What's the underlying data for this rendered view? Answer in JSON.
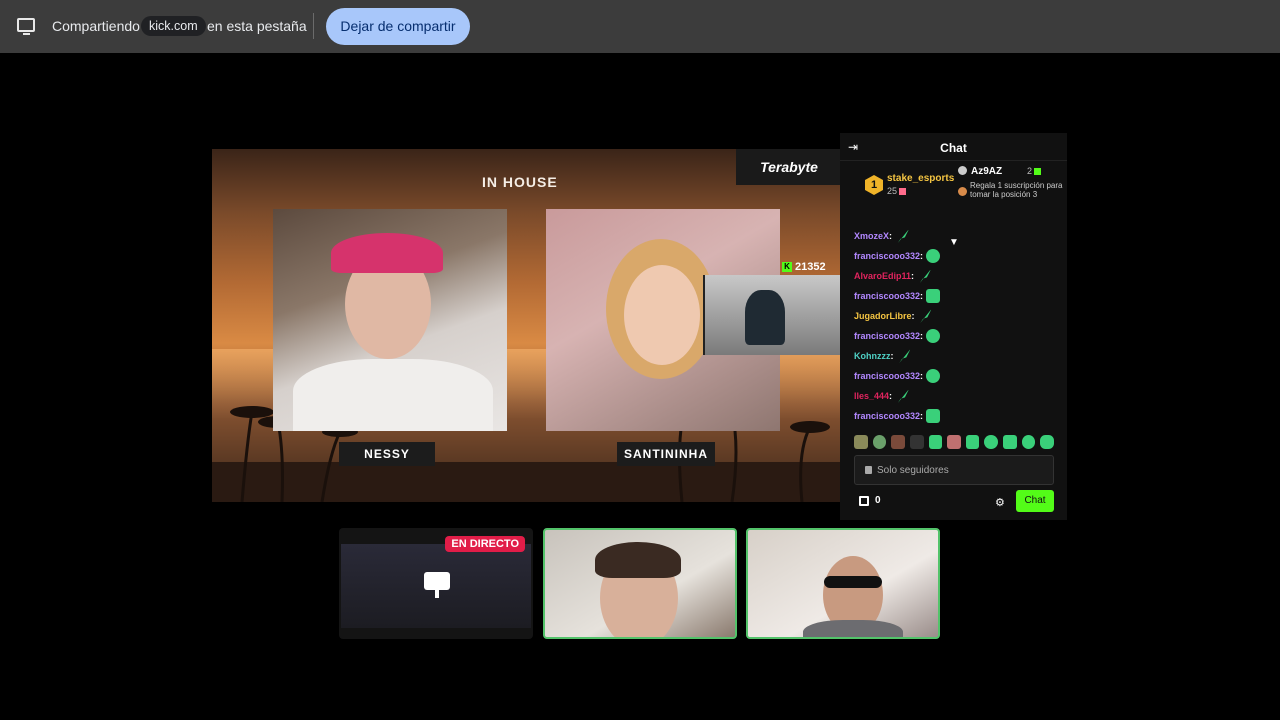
{
  "sharebar": {
    "sharing_prefix": "Compartiendo",
    "sharing_domain": "kick.com",
    "sharing_suffix": "en esta pestaña",
    "stop_button": "Dejar de compartir"
  },
  "stream": {
    "logo_left": "IN HOUSE",
    "logo_sponsor": "Terabyte",
    "viewer_count": "21352",
    "players": [
      {
        "name": "NESSY"
      },
      {
        "name": "SANTININHA"
      }
    ]
  },
  "chat": {
    "title": "Chat",
    "pinned": {
      "top_user": "stake_esports",
      "top_rank": "1",
      "top_count": "25",
      "second_user": "Az9AZ",
      "second_count": "2",
      "second_desc": "Regala 1 suscripción para tomar la posición 3"
    },
    "messages": [
      {
        "user": "XmozeX",
        "color": "#b388ff",
        "emote": "leaf"
      },
      {
        "user": "franciscooo332",
        "color": "#b388ff",
        "emote": "round"
      },
      {
        "user": "AlvaroEdip11",
        "color": "#e0245e",
        "emote": "leaf"
      },
      {
        "user": "franciscooo332",
        "color": "#b388ff",
        "emote": "square"
      },
      {
        "user": "JugadorLibre",
        "color": "#f5c542",
        "emote": "leaf"
      },
      {
        "user": "franciscooo332",
        "color": "#b388ff",
        "emote": "round"
      },
      {
        "user": "Kohnzzz",
        "color": "#4fd1c5",
        "emote": "leaf"
      },
      {
        "user": "franciscooo332",
        "color": "#b388ff",
        "emote": "round"
      },
      {
        "user": "lles_444",
        "color": "#e0245e",
        "emote": "leaf"
      },
      {
        "user": "franciscooo332",
        "color": "#b388ff",
        "emote": "square"
      }
    ],
    "input_placeholder": "Solo seguidores",
    "points": "0",
    "send_button": "Chat"
  },
  "thumbnails": {
    "live_badge": "EN DIRECTO"
  },
  "colors": {
    "kick_green": "#53fc18",
    "share_button_bg": "#a8c7fa",
    "live_red": "#e11d48"
  }
}
